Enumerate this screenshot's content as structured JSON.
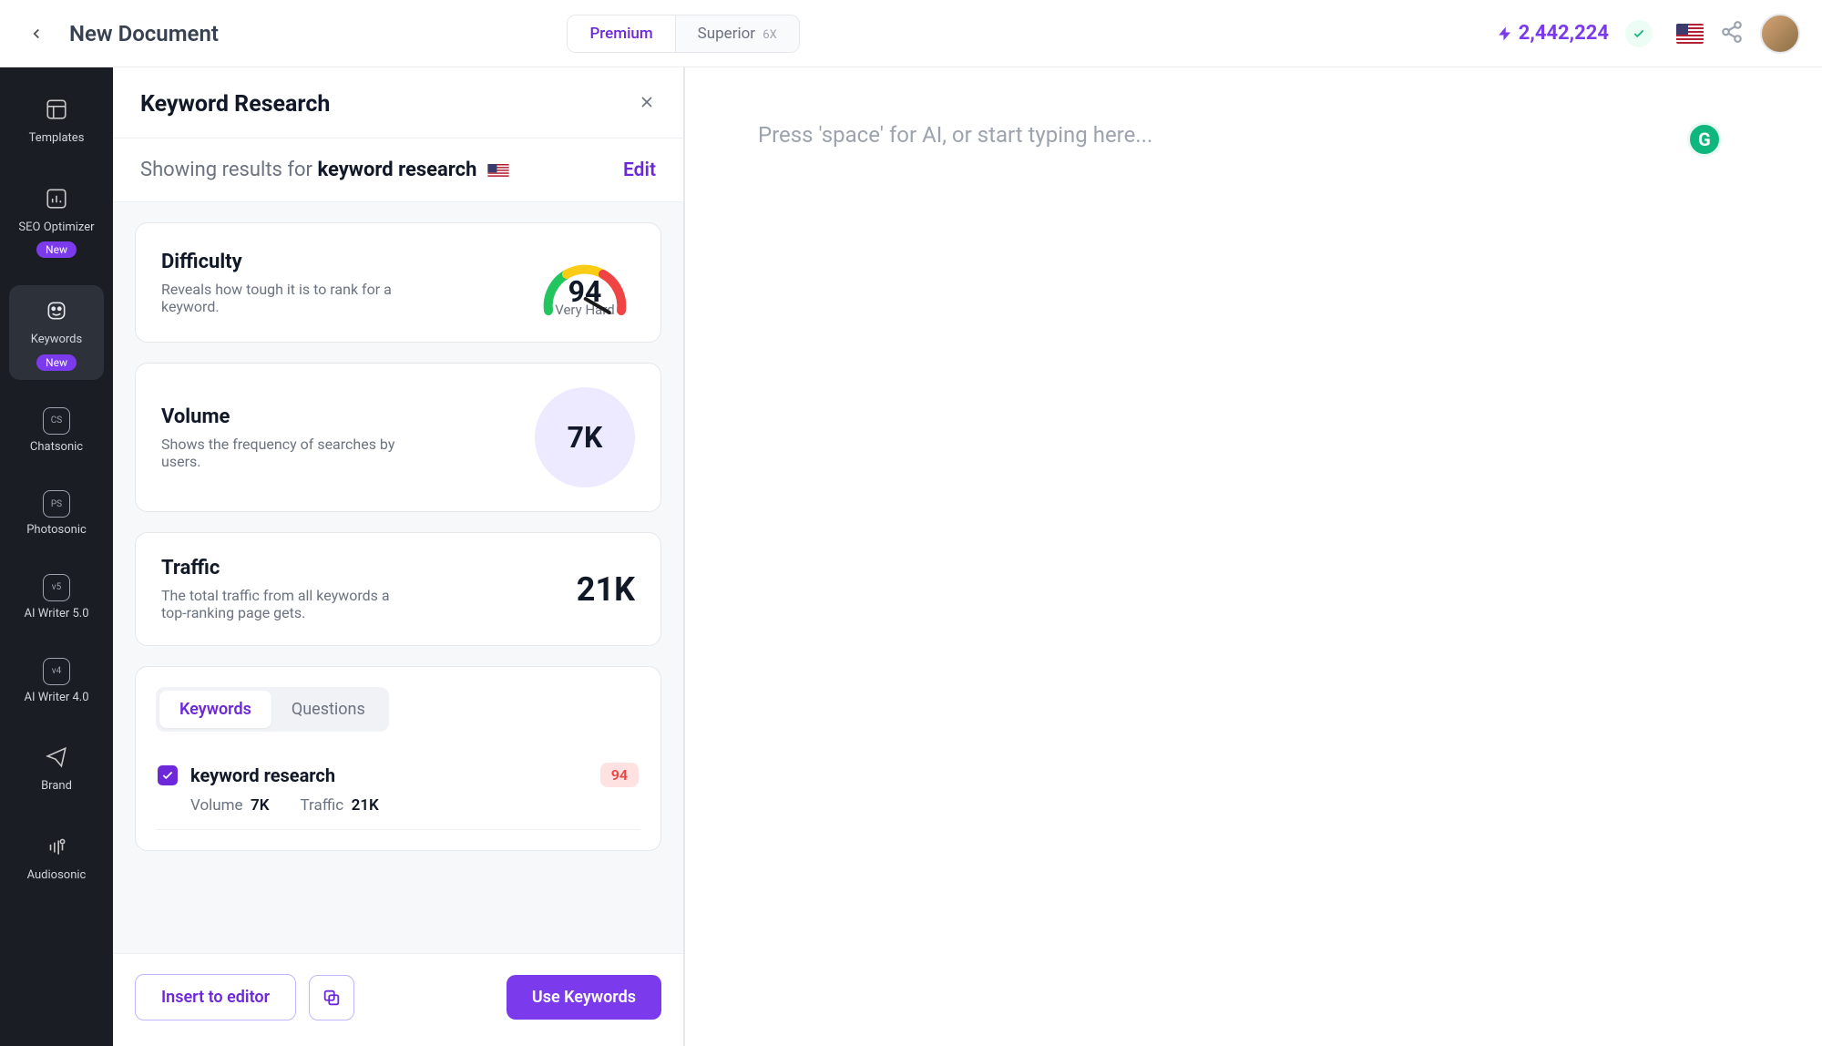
{
  "header": {
    "title": "New Document",
    "plans": {
      "premium": "Premium",
      "superior": "Superior",
      "superior_badge": "6X"
    },
    "credits": "2,442,224"
  },
  "sidebar": {
    "items": [
      {
        "label": "Templates"
      },
      {
        "label": "SEO Optimizer",
        "badge": "New"
      },
      {
        "label": "Keywords",
        "badge": "New"
      },
      {
        "label": "Chatsonic",
        "mini": "CS"
      },
      {
        "label": "Photosonic",
        "mini": "PS"
      },
      {
        "label": "AI Writer 5.0",
        "mini": "v5"
      },
      {
        "label": "AI Writer 4.0",
        "mini": "v4"
      },
      {
        "label": "Brand"
      },
      {
        "label": "Audiosonic"
      }
    ]
  },
  "panel": {
    "title": "Keyword Research",
    "results_prefix": "Showing results for",
    "results_term": "keyword research",
    "edit": "Edit",
    "difficulty": {
      "title": "Difficulty",
      "sub": "Reveals how tough it is to rank for a keyword.",
      "value": "94",
      "label": "Very Hard"
    },
    "volume": {
      "title": "Volume",
      "sub": "Shows the frequency of searches by users.",
      "value": "7K"
    },
    "traffic": {
      "title": "Traffic",
      "sub": "The total traffic from all keywords a top-ranking page gets.",
      "value": "21K"
    },
    "tabs": {
      "keywords": "Keywords",
      "questions": "Questions"
    },
    "kw_row": {
      "name": "keyword research",
      "diff": "94",
      "vol_label": "Volume",
      "vol_value": "7K",
      "traf_label": "Traffic",
      "traf_value": "21K"
    },
    "footer": {
      "insert": "Insert to editor",
      "use": "Use Keywords"
    }
  },
  "editor": {
    "placeholder": "Press 'space' for AI, or start typing here...",
    "grammarly": "G"
  }
}
